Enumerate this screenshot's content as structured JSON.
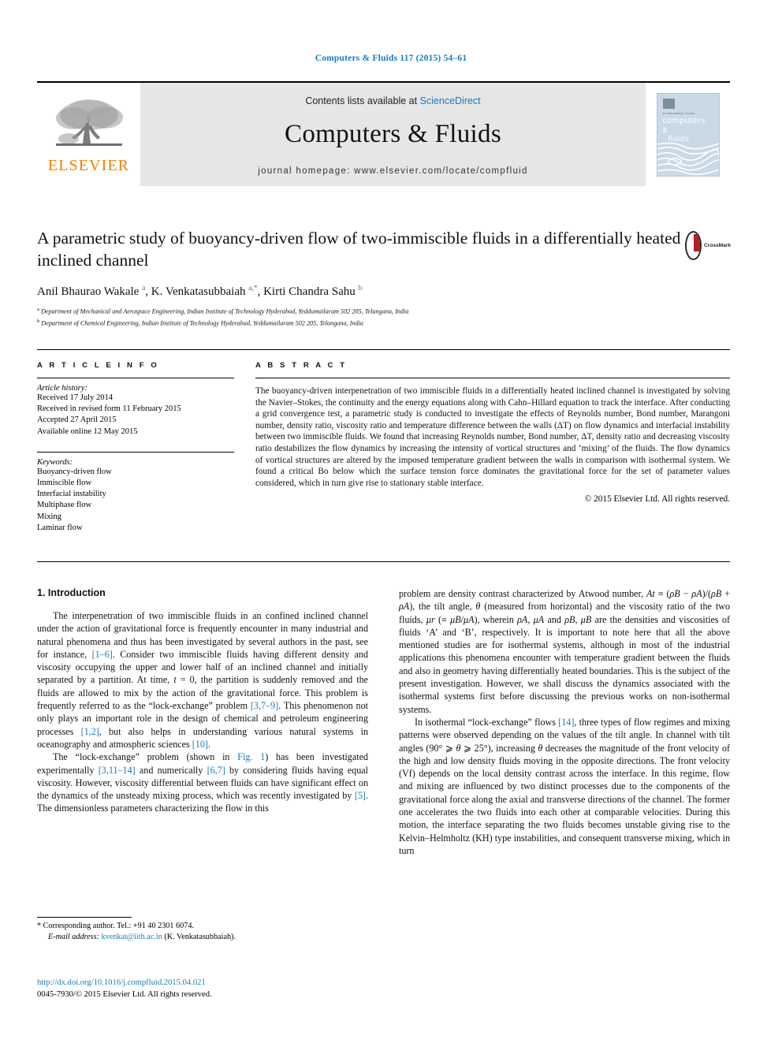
{
  "running_head": "Computers & Fluids 117 (2015) 54–61",
  "masthead": {
    "publisher": "ELSEVIER",
    "contents_prefix": "Contents lists available at ",
    "contents_link": "ScienceDirect",
    "journal_title": "Computers & Fluids",
    "homepage": "journal homepage: www.elsevier.com/locate/compfluid",
    "cover": {
      "sub": "An International Journal",
      "line1": "computers",
      "line2": "&",
      "line3": "fluids"
    }
  },
  "article": {
    "title": "A parametric study of buoyancy-driven flow of two-immiscible fluids in a differentially heated inclined channel",
    "crossmark_label": "CrossMark",
    "authors_html": "Anil Bhaurao Wakale <sup>a</sup>, K. Venkatasubbaiah <sup>a,*</sup>, Kirti Chandra Sahu <sup>b</sup>",
    "affiliation_a": "Department of Mechanical and Aerospace Engineering, Indian Institute of Technology Hyderabad, Yeddumailaram 502 205, Telangana, India",
    "affiliation_b": "Department of Chemical Engineering, Indian Institute of Technology Hyderabad, Yeddumailaram 502 205, Telangana, India"
  },
  "info": {
    "heading": "A R T I C L E    I N F O",
    "history_label": "Article history:",
    "history": [
      "Received 17 July 2014",
      "Received in revised form 11 February 2015",
      "Accepted 27 April 2015",
      "Available online 12 May 2015"
    ],
    "keywords_label": "Keywords:",
    "keywords": [
      "Buoyancy-driven flow",
      "Immiscible flow",
      "Interfacial instability",
      "Multiphase flow",
      "Mixing",
      "Laminar flow"
    ]
  },
  "abstract": {
    "heading": "A B S T R A C T",
    "text": "The buoyancy-driven interpenetration of two immiscible fluids in a differentially heated inclined channel is investigated by solving the Navier–Stokes, the continuity and the energy equations along with Cahn–Hillard equation to track the interface. After conducting a grid convergence test, a parametric study is conducted to investigate the effects of Reynolds number, Bond number, Marangoni number, density ratio, viscosity ratio and temperature difference between the walls (ΔT) on flow dynamics and interfacial instability between two immiscible fluids. We found that increasing Reynolds number, Bond number, ΔT, density ratio and decreasing viscosity ratio destabilizes the flow dynamics by increasing the intensity of vortical structures and ‘mixing’ of the fluids. The flow dynamics of vortical structures are altered by the imposed temperature gradient between the walls in comparison with isothermal system. We found a critical Bo below which the surface tension force dominates the gravitational force for the set of parameter values considered, which in turn give rise to stationary stable interface.",
    "copyright": "© 2015 Elsevier Ltd. All rights reserved."
  },
  "intro": {
    "heading": "1. Introduction",
    "left_p1": "The interpenetration of two immiscible fluids in an confined inclined channel under the action of gravitational force is frequently encounter in many industrial and natural phenomena and thus has been investigated by several authors in the past, see for instance, [1–6]. Consider two immiscible fluids having different density and viscosity occupying the upper and lower half of an inclined channel and initially separated by a partition. At time, t = 0, the partition is suddenly removed and the fluids are allowed to mix by the action of the gravitational force. This problem is frequently referred to as the “lock-exchange” problem [3,7–9]. This phenomenon not only plays an important role in the design of chemical and petroleum engineering processes [1,2], but also helps in understanding various natural systems in oceanography and atmospheric sciences [10].",
    "left_p2": "The “lock-exchange” problem (shown in Fig. 1) has been investigated experimentally [3,11–14] and numerically [6,7] by considering fluids having equal viscosity. However, viscosity differential between fluids can have significant effect on the dynamics of the unsteady mixing process, which was recently investigated by [5]. The dimensionless parameters characterizing the flow in this",
    "right_p1": "problem are density contrast characterized by Atwood number, At ≡ (ρB − ρA)/(ρB + ρA), the tilt angle, θ (measured from horizontal) and the viscosity ratio of the two fluids, μr (≡ μB/μA), wherein ρA, μA and ρB, μB are the densities and viscosities of fluids ‘A’ and ‘B’, respectively. It is important to note here that all the above mentioned studies are for isothermal systems, although in most of the industrial applications this phenomena encounter with temperature gradient between the fluids and also in geometry having differentially heated boundaries. This is the subject of the present investigation. However, we shall discuss the dynamics associated with the isothermal systems first before discussing the previous works on non-isothermal systems.",
    "right_p2": "In isothermal “lock-exchange” flows [14], three types of flow regimes and mixing patterns were observed depending on the values of the tilt angle. In channel with tilt angles (90° ⩾ θ ⩾ 25°), increasing θ decreases the magnitude of the front velocity of the high and low density fluids moving in the opposite directions. The front velocity (Vf) depends on the local density contrast across the interface. In this regime, flow and mixing are influenced by two distinct processes due to the components of the gravitational force along the axial and transverse directions of the channel. The former one accelerates the two fluids into each other at comparable velocities. During this motion, the interface separating the two fluids becomes unstable giving rise to the Kelvin–Helmholtz (KH) type instabilities, and consequent transverse mixing, which in turn"
  },
  "footer": {
    "corresponding": "* Corresponding author. Tel.: +91 40 2301 6074.",
    "email_label": "E-mail address:",
    "email": "kvenkat@iith.ac.in",
    "email_suffix": "(K. Venkatasubbaiah).",
    "doi": "http://dx.doi.org/10.1016/j.compfluid.2015.04.021",
    "issn_line": "0045-7930/© 2015 Elsevier Ltd. All rights reserved."
  },
  "colors": {
    "link": "#1a7bb9",
    "elsevier_orange": "#f08000",
    "masthead_bg": "#e6e6e6"
  }
}
